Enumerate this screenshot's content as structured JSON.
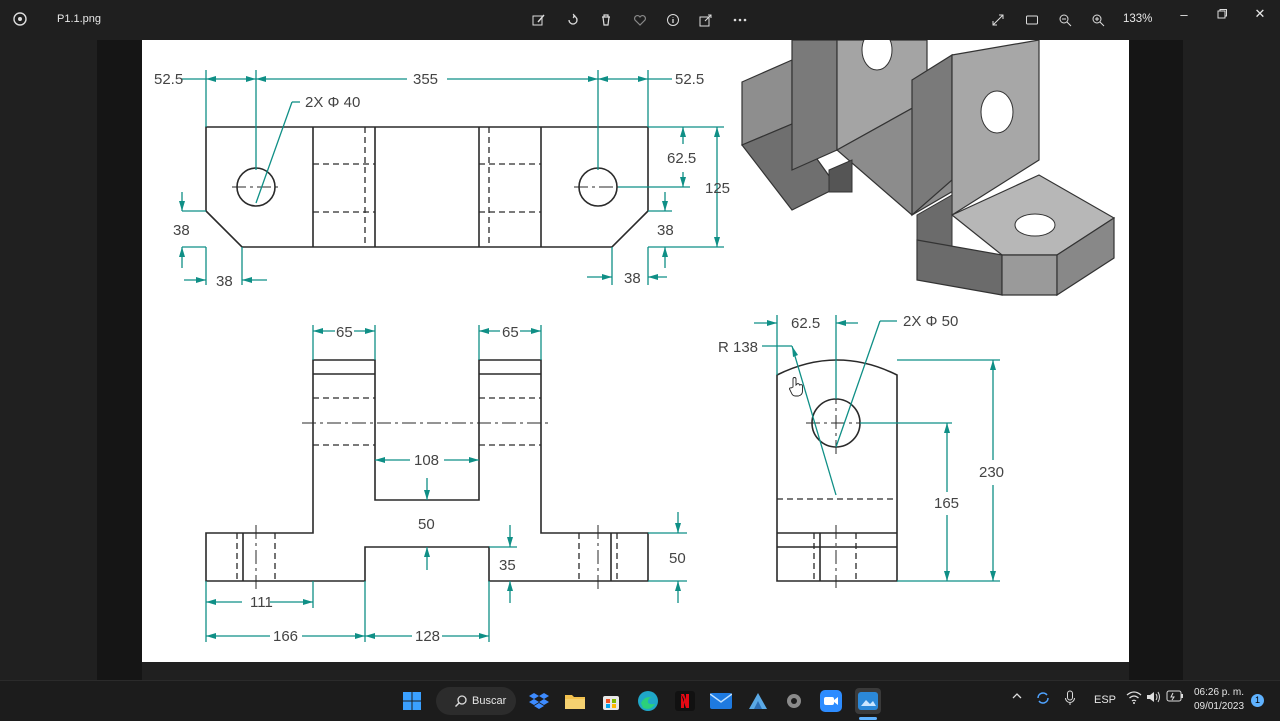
{
  "titlebar": {
    "filename": "P1.1.png",
    "zoom": "133%",
    "toolbar_icons": [
      "edit-icon",
      "rotate-icon",
      "delete-icon",
      "favorite-icon",
      "info-icon",
      "share-icon",
      "more-icon"
    ],
    "right_icons": [
      "expand-icon",
      "crop-icon",
      "zoom-out-icon",
      "zoom-in-icon"
    ]
  },
  "drawing": {
    "top_view": {
      "dim_left": "52.5",
      "dim_center": "355",
      "dim_right": "52.5",
      "hole_callout": "2X Φ 40",
      "dim_62_5": "62.5",
      "dim_125": "125",
      "dim_38_left_v": "38",
      "dim_38_left_h": "38",
      "dim_38_right_v": "38",
      "dim_38_right_h": "38"
    },
    "front_view": {
      "dim_65_left": "65",
      "dim_65_right": "65",
      "dim_108": "108",
      "dim_50_mid": "50",
      "dim_35": "35",
      "dim_50_right": "50",
      "dim_111": "111",
      "dim_166": "166",
      "dim_128": "128"
    },
    "side_view": {
      "dim_62_5": "62.5",
      "hole_callout": "2X Φ 50",
      "radius": "R 138",
      "dim_230": "230",
      "dim_165": "165"
    }
  },
  "taskbar": {
    "search_label": "Buscar",
    "language": "ESP",
    "time": "06:26 p. m.",
    "date": "09/01/2023",
    "notification_count": "1"
  }
}
